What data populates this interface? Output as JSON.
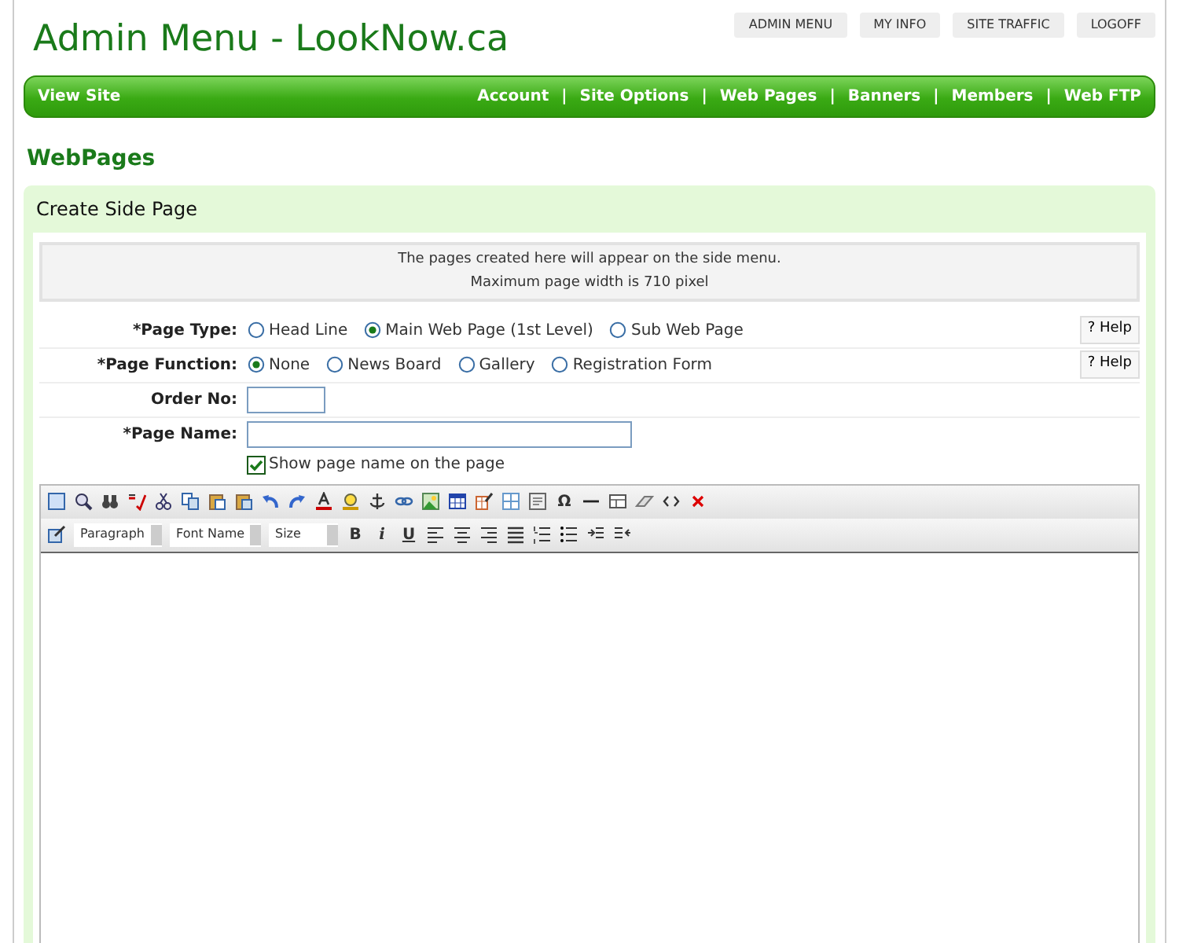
{
  "header": {
    "title": "Admin Menu - LookNow.ca",
    "top_links": [
      "ADMIN MENU",
      "MY INFO",
      "SITE TRAFFIC",
      "LOGOFF"
    ]
  },
  "navbar": {
    "left": "View Site",
    "links": [
      "Account",
      "Site Options",
      "Web Pages",
      "Banners",
      "Members",
      "Web FTP"
    ],
    "separator": "|"
  },
  "page_heading": "WebPages",
  "panel": {
    "title": "Create Side Page",
    "notice": [
      "The pages created here will appear on the side menu.",
      "Maximum page width is 710 pixel"
    ],
    "page_type": {
      "label": "*Page Type:",
      "help": "? Help",
      "options": [
        {
          "label": "Head Line",
          "selected": false
        },
        {
          "label": "Main Web Page (1st Level)",
          "selected": true
        },
        {
          "label": "Sub Web Page",
          "selected": false
        }
      ]
    },
    "page_function": {
      "label": "*Page Function:",
      "help": "? Help",
      "options": [
        {
          "label": "None",
          "selected": true
        },
        {
          "label": "News Board",
          "selected": false
        },
        {
          "label": "Gallery",
          "selected": false
        },
        {
          "label": "Registration Form",
          "selected": false
        }
      ]
    },
    "order_no": {
      "label": "Order No:"
    },
    "page_name": {
      "label": "*Page Name:"
    },
    "show_name": {
      "label": "Show page name on the page",
      "checked": true
    },
    "editor": {
      "special_char": "Ω",
      "selects": [
        "Paragraph",
        "Font Name",
        "Size"
      ],
      "format_buttons": [
        "B",
        "i",
        "U"
      ]
    }
  }
}
